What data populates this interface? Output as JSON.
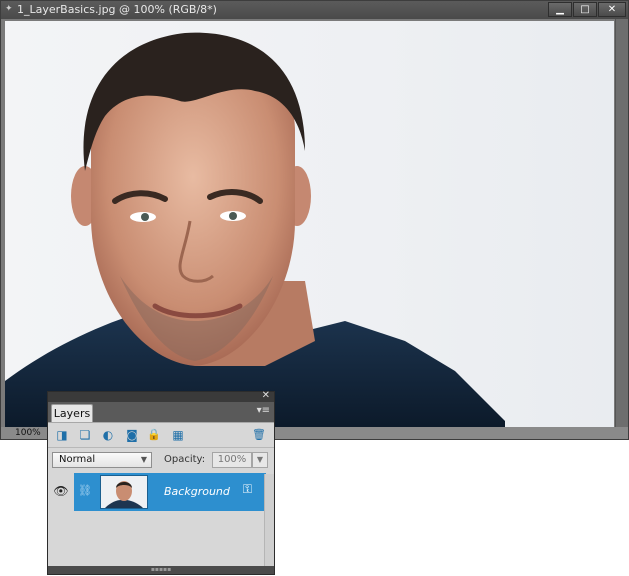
{
  "document": {
    "title": "1_LayerBasics.jpg @ 100% (RGB/8*)",
    "zoom": "100%",
    "window_buttons": {
      "minimize": "▁",
      "maximize": "□",
      "close": "✕"
    }
  },
  "layers_panel": {
    "tab": "Layers",
    "close_glyph": "✕",
    "menu_glyph": "▾≡",
    "toolbar": {
      "new_layer_icon": "◨",
      "new_group_icon": "❏",
      "adjustment_icon": "◐",
      "mask_icon": "◙",
      "lock_all_icon": "🔒",
      "lock_transparent_icon": "▦",
      "delete_icon": "🗑"
    },
    "blend_mode": "Normal",
    "opacity_label": "Opacity:",
    "opacity_value": "100%",
    "layers": [
      {
        "name": "Background",
        "visible": true,
        "selected": true
      }
    ],
    "eye_glyph": "👁",
    "link_glyph": "⛓",
    "lock_glyph": "⚿",
    "dropdown_glyph": "▼"
  },
  "colors": {
    "selection": "#2d8fcf",
    "panel_bg": "#d7d7d7",
    "titlebar": "#4a4a4a"
  }
}
